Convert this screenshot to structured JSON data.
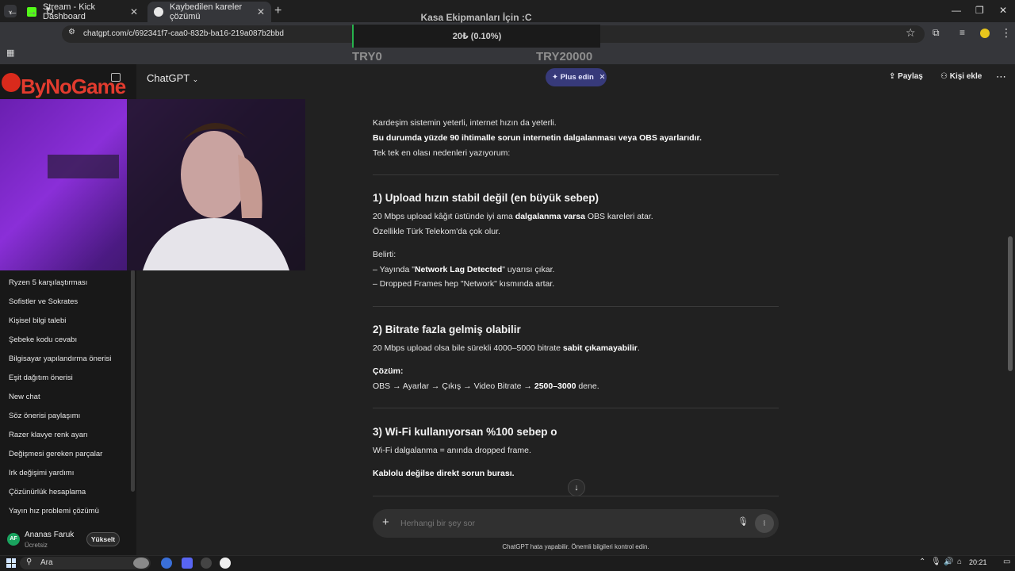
{
  "browser": {
    "tabs": [
      {
        "title": "Stream - Kick Dashboard",
        "active": false
      },
      {
        "title": "Kaybedilen kareler çözümü",
        "active": true
      }
    ],
    "url": "chatgpt.com/c/692341f7-caa0-832b-ba16-219a087b2bbd"
  },
  "overlay": {
    "donation_title": "Kasa Ekipmanları İçin :C",
    "donation_amount": "20₺ (0.10%)",
    "progress": 0.001,
    "min_label": "TRY0",
    "max_label": "TRY20000",
    "logo_text": "ByNoGame"
  },
  "header": {
    "model": "ChatGPT",
    "plus_label": "Plus edin",
    "share_label": "Paylaş",
    "add_person_label": "Kişi ekle"
  },
  "sidebar": {
    "items": [
      "Ryzen 5 karşılaştırması",
      "Sofistler ve Sokrates",
      "Kişisel bilgi talebi",
      "Şebeke kodu cevabı",
      "Bilgisayar yapılandırma önerisi",
      "Eşit dağıtım önerisi",
      "New chat",
      "Söz önerisi paylaşımı",
      "Razer klavye renk ayarı",
      "Değişmesi gereken parçalar",
      "Irk değişimi yardımı",
      "Çözünürlük hesaplama",
      "Yayın hız problemi çözümü"
    ],
    "user": {
      "initials": "AF",
      "name": "Ananas Faruk",
      "plan": "Ücretsiz",
      "upgrade_label": "Yükselt"
    }
  },
  "chat": {
    "intro_1": "Kardeşim sistemin yeterli, internet hızın da yeterli.",
    "intro_2": "Bu durumda yüzde 90 ihtimalle sorun internetin dalgalanması veya OBS ayarlarıdır.",
    "intro_3": "Tek tek en olası nedenleri yazıyorum:",
    "s1_title": "1) Upload hızın stabil değil (en büyük sebep)",
    "s1_p1_a": "20 Mbps upload kâğıt üstünde iyi ama ",
    "s1_p1_b": "dalgalanma varsa",
    "s1_p1_c": " OBS kareleri atar.",
    "s1_p2": "Özellikle Türk Telekom'da çok olur.",
    "s1_sym": "Belirti:",
    "s1_l1_a": "– Yayında \"",
    "s1_l1_b": "Network Lag Detected",
    "s1_l1_c": "\" uyarısı çıkar.",
    "s1_l2": "– Dropped Frames hep \"Network\" kısmında artar.",
    "s2_title": "2) Bitrate fazla gelmiş olabilir",
    "s2_p1_a": "20 Mbps upload olsa bile sürekli 4000–5000 bitrate ",
    "s2_p1_b": "sabit çıkamayabilir",
    "s2_p1_c": ".",
    "s2_sol": "Çözüm:",
    "s2_p2_a": "OBS → Ayarlar → Çıkış → Video Bitrate → ",
    "s2_p2_b": "2500–3000",
    "s2_p2_c": " dene.",
    "s3_title": "3) Wi-Fi kullanıyorsan %100 sebep o",
    "s3_p1": "Wi-Fi dalgalanma = anında dropped frame.",
    "s3_p2": "Kablolu değilse direkt sorun burası."
  },
  "composer": {
    "placeholder": "Herhangi bir şey sor",
    "disclaimer": "ChatGPT hata yapabilir. Önemli bilgileri kontrol edin."
  },
  "taskbar": {
    "search_label": "Ara",
    "time": "20:21"
  },
  "colors": {
    "accent_plus": "#373a7a",
    "kick_green": "#53fc18",
    "logo_red": "#e23b2e"
  }
}
